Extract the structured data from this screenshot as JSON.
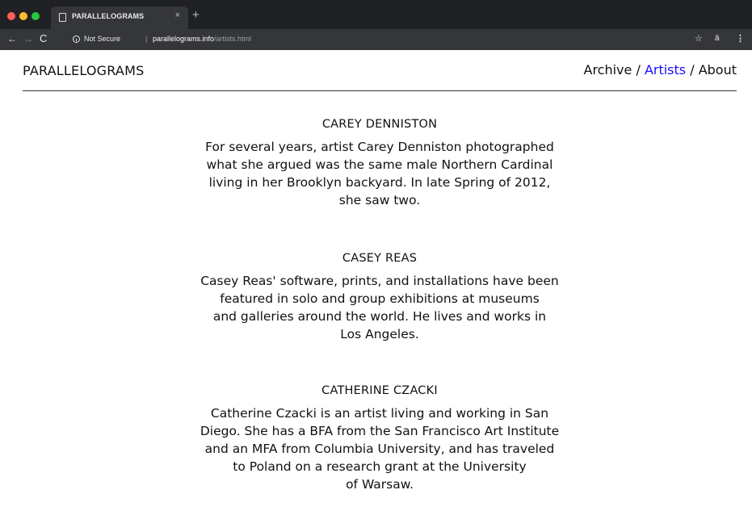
{
  "browser": {
    "tab_title": "PARALLELOGRAMS",
    "tab_close": "×",
    "new_tab": "+",
    "back": "←",
    "forward": "→",
    "reload": "C",
    "security_label": "Not Secure",
    "separator": "|",
    "url_host": "parallelograms.info",
    "url_path": "/artists.html",
    "star": "☆",
    "extension": "ä",
    "menu": "⋮"
  },
  "site": {
    "title": "PARALLELOGRAMS",
    "nav": {
      "archive": "Archive",
      "sep1": " / ",
      "artists": "Artists",
      "sep2": " / ",
      "about": "About"
    },
    "active_color": "#1a0dff"
  },
  "artists": [
    {
      "name": "CAREY DENNISTON",
      "bio_lines": [
        "For several years, artist Carey Denniston photographed",
        "what she argued was the same male Northern Cardinal",
        "living in her Brooklyn backyard. In late Spring of 2012,",
        "she saw two."
      ]
    },
    {
      "name": "CASEY REAS",
      "bio_lines": [
        "Casey Reas' software, prints, and installations have been",
        "featured in solo and group exhibitions at museums",
        "and galleries around the world. He lives and works in",
        "Los Angeles."
      ]
    },
    {
      "name": "CATHERINE CZACKI",
      "bio_lines": [
        "Catherine Czacki is an artist living and working in San",
        "Diego. She has a BFA from the San Francisco Art Institute",
        "and an MFA from Columbia University, and has traveled",
        "to Poland on a research grant at the University",
        "of Warsaw."
      ]
    }
  ]
}
